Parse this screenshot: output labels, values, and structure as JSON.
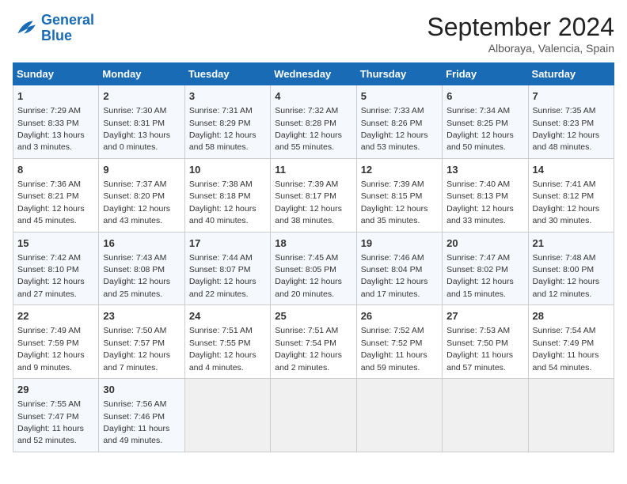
{
  "logo": {
    "line1": "General",
    "line2": "Blue"
  },
  "header": {
    "month": "September 2024",
    "location": "Alboraya, Valencia, Spain"
  },
  "weekdays": [
    "Sunday",
    "Monday",
    "Tuesday",
    "Wednesday",
    "Thursday",
    "Friday",
    "Saturday"
  ],
  "weeks": [
    [
      {
        "day": "1",
        "sunrise": "Sunrise: 7:29 AM",
        "sunset": "Sunset: 8:33 PM",
        "daylight": "Daylight: 13 hours and 3 minutes."
      },
      {
        "day": "2",
        "sunrise": "Sunrise: 7:30 AM",
        "sunset": "Sunset: 8:31 PM",
        "daylight": "Daylight: 13 hours and 0 minutes."
      },
      {
        "day": "3",
        "sunrise": "Sunrise: 7:31 AM",
        "sunset": "Sunset: 8:29 PM",
        "daylight": "Daylight: 12 hours and 58 minutes."
      },
      {
        "day": "4",
        "sunrise": "Sunrise: 7:32 AM",
        "sunset": "Sunset: 8:28 PM",
        "daylight": "Daylight: 12 hours and 55 minutes."
      },
      {
        "day": "5",
        "sunrise": "Sunrise: 7:33 AM",
        "sunset": "Sunset: 8:26 PM",
        "daylight": "Daylight: 12 hours and 53 minutes."
      },
      {
        "day": "6",
        "sunrise": "Sunrise: 7:34 AM",
        "sunset": "Sunset: 8:25 PM",
        "daylight": "Daylight: 12 hours and 50 minutes."
      },
      {
        "day": "7",
        "sunrise": "Sunrise: 7:35 AM",
        "sunset": "Sunset: 8:23 PM",
        "daylight": "Daylight: 12 hours and 48 minutes."
      }
    ],
    [
      {
        "day": "8",
        "sunrise": "Sunrise: 7:36 AM",
        "sunset": "Sunset: 8:21 PM",
        "daylight": "Daylight: 12 hours and 45 minutes."
      },
      {
        "day": "9",
        "sunrise": "Sunrise: 7:37 AM",
        "sunset": "Sunset: 8:20 PM",
        "daylight": "Daylight: 12 hours and 43 minutes."
      },
      {
        "day": "10",
        "sunrise": "Sunrise: 7:38 AM",
        "sunset": "Sunset: 8:18 PM",
        "daylight": "Daylight: 12 hours and 40 minutes."
      },
      {
        "day": "11",
        "sunrise": "Sunrise: 7:39 AM",
        "sunset": "Sunset: 8:17 PM",
        "daylight": "Daylight: 12 hours and 38 minutes."
      },
      {
        "day": "12",
        "sunrise": "Sunrise: 7:39 AM",
        "sunset": "Sunset: 8:15 PM",
        "daylight": "Daylight: 12 hours and 35 minutes."
      },
      {
        "day": "13",
        "sunrise": "Sunrise: 7:40 AM",
        "sunset": "Sunset: 8:13 PM",
        "daylight": "Daylight: 12 hours and 33 minutes."
      },
      {
        "day": "14",
        "sunrise": "Sunrise: 7:41 AM",
        "sunset": "Sunset: 8:12 PM",
        "daylight": "Daylight: 12 hours and 30 minutes."
      }
    ],
    [
      {
        "day": "15",
        "sunrise": "Sunrise: 7:42 AM",
        "sunset": "Sunset: 8:10 PM",
        "daylight": "Daylight: 12 hours and 27 minutes."
      },
      {
        "day": "16",
        "sunrise": "Sunrise: 7:43 AM",
        "sunset": "Sunset: 8:08 PM",
        "daylight": "Daylight: 12 hours and 25 minutes."
      },
      {
        "day": "17",
        "sunrise": "Sunrise: 7:44 AM",
        "sunset": "Sunset: 8:07 PM",
        "daylight": "Daylight: 12 hours and 22 minutes."
      },
      {
        "day": "18",
        "sunrise": "Sunrise: 7:45 AM",
        "sunset": "Sunset: 8:05 PM",
        "daylight": "Daylight: 12 hours and 20 minutes."
      },
      {
        "day": "19",
        "sunrise": "Sunrise: 7:46 AM",
        "sunset": "Sunset: 8:04 PM",
        "daylight": "Daylight: 12 hours and 17 minutes."
      },
      {
        "day": "20",
        "sunrise": "Sunrise: 7:47 AM",
        "sunset": "Sunset: 8:02 PM",
        "daylight": "Daylight: 12 hours and 15 minutes."
      },
      {
        "day": "21",
        "sunrise": "Sunrise: 7:48 AM",
        "sunset": "Sunset: 8:00 PM",
        "daylight": "Daylight: 12 hours and 12 minutes."
      }
    ],
    [
      {
        "day": "22",
        "sunrise": "Sunrise: 7:49 AM",
        "sunset": "Sunset: 7:59 PM",
        "daylight": "Daylight: 12 hours and 9 minutes."
      },
      {
        "day": "23",
        "sunrise": "Sunrise: 7:50 AM",
        "sunset": "Sunset: 7:57 PM",
        "daylight": "Daylight: 12 hours and 7 minutes."
      },
      {
        "day": "24",
        "sunrise": "Sunrise: 7:51 AM",
        "sunset": "Sunset: 7:55 PM",
        "daylight": "Daylight: 12 hours and 4 minutes."
      },
      {
        "day": "25",
        "sunrise": "Sunrise: 7:51 AM",
        "sunset": "Sunset: 7:54 PM",
        "daylight": "Daylight: 12 hours and 2 minutes."
      },
      {
        "day": "26",
        "sunrise": "Sunrise: 7:52 AM",
        "sunset": "Sunset: 7:52 PM",
        "daylight": "Daylight: 11 hours and 59 minutes."
      },
      {
        "day": "27",
        "sunrise": "Sunrise: 7:53 AM",
        "sunset": "Sunset: 7:50 PM",
        "daylight": "Daylight: 11 hours and 57 minutes."
      },
      {
        "day": "28",
        "sunrise": "Sunrise: 7:54 AM",
        "sunset": "Sunset: 7:49 PM",
        "daylight": "Daylight: 11 hours and 54 minutes."
      }
    ],
    [
      {
        "day": "29",
        "sunrise": "Sunrise: 7:55 AM",
        "sunset": "Sunset: 7:47 PM",
        "daylight": "Daylight: 11 hours and 52 minutes."
      },
      {
        "day": "30",
        "sunrise": "Sunrise: 7:56 AM",
        "sunset": "Sunset: 7:46 PM",
        "daylight": "Daylight: 11 hours and 49 minutes."
      },
      null,
      null,
      null,
      null,
      null
    ]
  ]
}
